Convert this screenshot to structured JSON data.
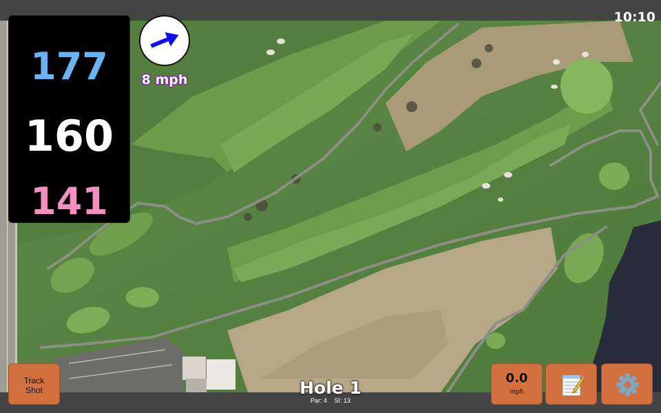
{
  "status_bar": {
    "time": "10:10"
  },
  "yardages": {
    "back": "177",
    "middle": "160",
    "front": "141"
  },
  "wind": {
    "speed": "8 mph",
    "icon": "wind-arrow-icon"
  },
  "hole": {
    "title": "Hole 1",
    "par": "Par: 4",
    "stroke_index": "SI: 13"
  },
  "buttons": {
    "track_shot": [
      "Track",
      "Shot"
    ],
    "speed_value": "0.0",
    "speed_unit": "mph",
    "notes_icon": "notepad-icon",
    "settings_icon": "gear-icon"
  },
  "colors": {
    "back_yardage": "#6ab4f5",
    "middle_yardage": "#ffffff",
    "front_yardage": "#f48fc4",
    "button": "#d2703f",
    "wind_arrow": "#1010ee"
  }
}
